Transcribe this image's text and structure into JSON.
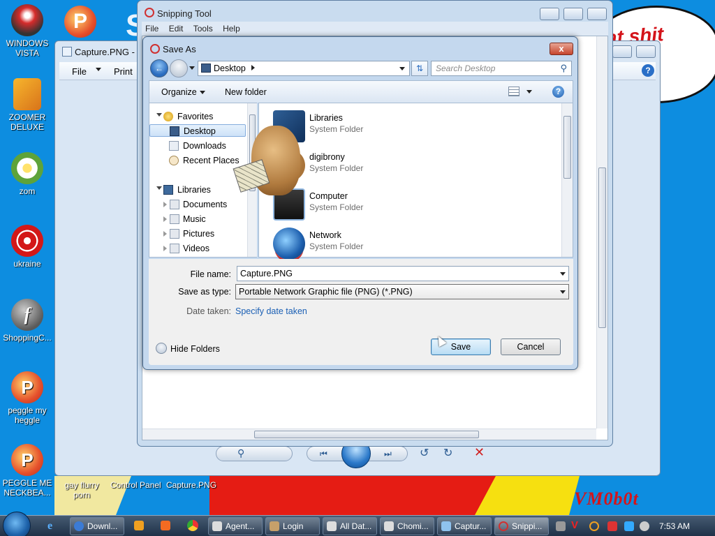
{
  "desktop": {
    "icons": [
      {
        "label_line1": "WINDOWS",
        "label_line2": "VISTA"
      },
      {
        "label_line1": "ZOOMER",
        "label_line2": "DELUXE"
      },
      {
        "label_line1": "zom",
        "label_line2": ""
      },
      {
        "label_line1": "ukraine",
        "label_line2": ""
      },
      {
        "label_line1": "ShoppingC...",
        "label_line2": ""
      },
      {
        "label_line1": "peggle my",
        "label_line2": "heggle"
      },
      {
        "label_line1": "PEGGLE ME",
        "label_line2": "NECKBEA..."
      }
    ],
    "bottom_labels": [
      "gay flurry porn",
      "Control Panel",
      "Capture.PNG"
    ],
    "wallpaper_text": "at shit",
    "wallpaper_text2": "v",
    "wallpaper_signature": "VM0b0t",
    "wallpaper_s": "S"
  },
  "back_window": {
    "title": "Capture.PNG - W",
    "file_menu": "File",
    "print_menu": "Print"
  },
  "snipping_tool": {
    "title": "Snipping Tool",
    "menu": [
      "File",
      "Edit",
      "Tools",
      "Help"
    ]
  },
  "save_dialog": {
    "title": "Save As",
    "close_label": "x",
    "address": "Desktop",
    "search_placeholder": "Search Desktop",
    "organize": "Organize",
    "new_folder": "New folder",
    "help": "?",
    "nav": {
      "favorites": "Favorites",
      "desktop": "Desktop",
      "downloads": "Downloads",
      "recent": "Recent Places",
      "libraries": "Libraries",
      "documents": "Documents",
      "music": "Music",
      "pictures": "Pictures",
      "videos": "Videos"
    },
    "files": [
      {
        "name": "Libraries",
        "type": "System Folder"
      },
      {
        "name": "digibrony",
        "type": "System Folder"
      },
      {
        "name": "Computer",
        "type": "System Folder"
      },
      {
        "name": "Network",
        "type": "System Folder"
      }
    ],
    "form": {
      "filename_label": "File name:",
      "filename_value": "Capture.PNG",
      "type_label": "Save as type:",
      "type_value": "Portable Network Graphic file (PNG) (*.PNG)",
      "date_label": "Date taken:",
      "date_link": "Specify date taken",
      "hide_folders": "Hide Folders",
      "save": "Save",
      "cancel": "Cancel"
    }
  },
  "taskbar": {
    "items": [
      "Downl...",
      "",
      "",
      "",
      "Agent...",
      "Login",
      "All Dat...",
      "Chomi...",
      "Captur...",
      "Snippi..."
    ],
    "clock": "7:53 AM"
  },
  "colors": {
    "desktop_bg": "#0d8de0",
    "accent_red": "#d4141a",
    "link_blue": "#1a5fb4"
  }
}
